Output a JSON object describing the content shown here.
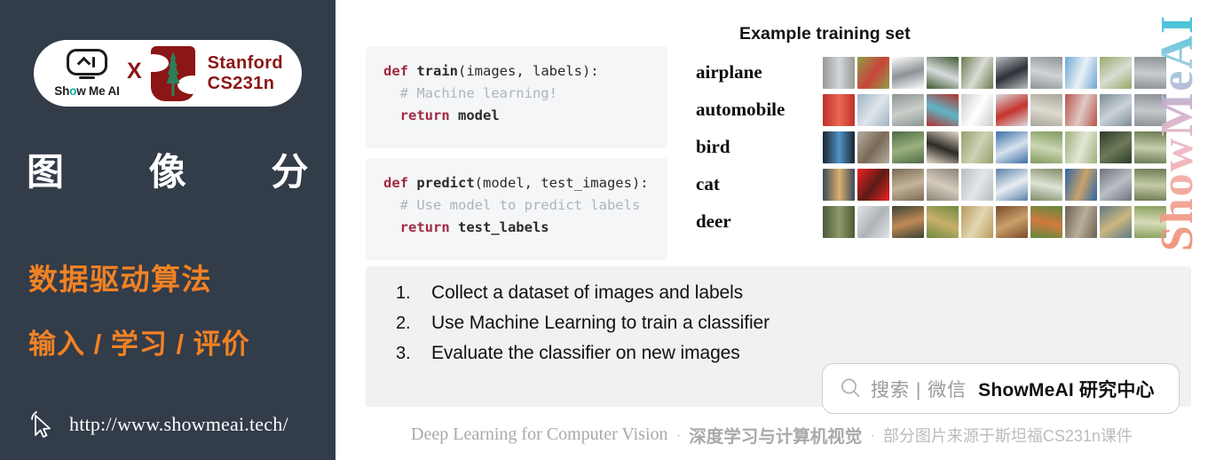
{
  "sidebar": {
    "logo": {
      "showmeai_name": "Show Me AI",
      "showmeai_icon": "ai-robot-icon",
      "cross_symbol": "X",
      "stanford_icon": "stanford-tree-icon",
      "stanford_line1": "Stanford",
      "stanford_line2": "CS231n"
    },
    "title": "图 像 分 类",
    "keyword_1": "数据驱动算法",
    "keyword_2": "输入 / 学习 / 评价",
    "cursor_icon": "cursor-pointer-icon",
    "url": "http://www.showmeai.tech/",
    "colors": {
      "background": "#333c49",
      "accent": "#F08224",
      "stanford_red": "#8C1515"
    }
  },
  "main": {
    "code_train": {
      "line1_kw": "def",
      "line1_fn": " train",
      "line1_rest": "(images, labels):",
      "line2_comment": "  # Machine learning!",
      "line3_kw": "  return",
      "line3_rest": " model"
    },
    "code_predict": {
      "line1_kw": "def",
      "line1_fn": " predict",
      "line1_rest": "(model, test_images):",
      "line2_comment": "  # Use model to predict labels",
      "line3_kw": "  return",
      "line3_rest": " test_labels"
    },
    "training_set": {
      "title": "Example training set",
      "classes": [
        "airplane",
        "automobile",
        "bird",
        "cat",
        "deer"
      ],
      "columns": 10
    },
    "steps": {
      "items": [
        {
          "num": "1.",
          "text": "Collect a dataset of images and labels"
        },
        {
          "num": "2.",
          "text": "Use Machine Learning to train a classifier"
        },
        {
          "num": "3.",
          "text": "Evaluate the classifier on new images"
        }
      ]
    },
    "search_pill": {
      "icon": "search-magnifier-icon",
      "gray_text": "搜索 | 微信",
      "bold_text": "ShowMeAI 研究中心"
    },
    "footer": {
      "english": "Deep Learning for Computer Vision",
      "dot1": "·",
      "chinese_bold": "深度学习与计算机视觉",
      "dot2": "·",
      "chinese_light": "部分图片来源于斯坦福CS231n课件"
    },
    "watermark": "ShowMeAI"
  }
}
